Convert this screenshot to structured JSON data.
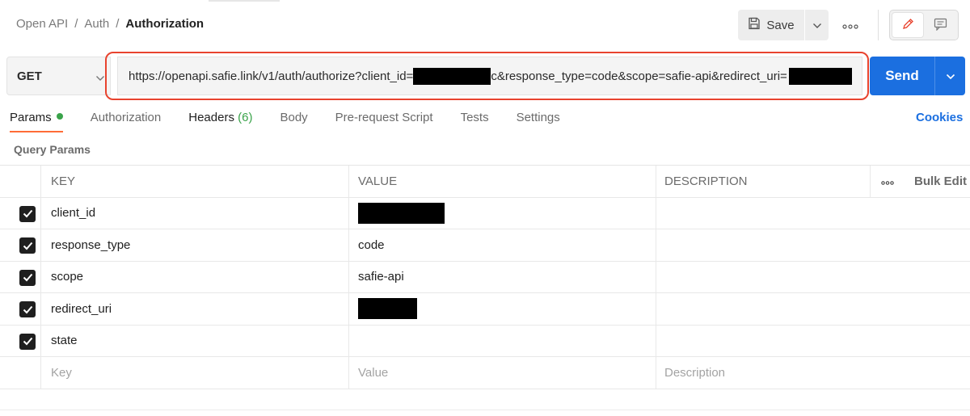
{
  "breadcrumb": {
    "items": [
      "Open API",
      "Auth"
    ],
    "separator": "/",
    "current": "Authorization"
  },
  "toolbar": {
    "save_label": "Save",
    "icons": [
      "save-icon",
      "chevron-down-icon",
      "more-icon",
      "pencil-icon",
      "comment-icon"
    ]
  },
  "request": {
    "method": "GET",
    "url_part1": "https://openapi.safie.link/v1/auth/authorize?client_id=",
    "url_part2": "c&response_type=code&scope=safie-api&redirect_uri=",
    "send_label": "Send"
  },
  "tabs": [
    {
      "label": "Params",
      "active": true
    },
    {
      "label": "Authorization"
    },
    {
      "label": "Headers",
      "count": "(6)"
    },
    {
      "label": "Body"
    },
    {
      "label": "Pre-request Script"
    },
    {
      "label": "Tests"
    },
    {
      "label": "Settings"
    }
  ],
  "cookies_label": "Cookies",
  "section_title": "Query Params",
  "table": {
    "headers": {
      "key": "KEY",
      "value": "VALUE",
      "description": "DESCRIPTION",
      "bulk": "Bulk Edit"
    },
    "rows": [
      {
        "key": "client_id",
        "value": "",
        "redacted": true,
        "checked": true
      },
      {
        "key": "response_type",
        "value": "code",
        "checked": true
      },
      {
        "key": "scope",
        "value": "safie-api",
        "checked": true
      },
      {
        "key": "redirect_uri",
        "value": "",
        "redacted": true,
        "checked": true
      },
      {
        "key": "state",
        "value": "",
        "checked": true
      }
    ],
    "placeholders": {
      "key": "Key",
      "value": "Value",
      "description": "Description"
    }
  },
  "colors": {
    "accent_blue": "#1b6fe0",
    "highlight_red": "#e8432e",
    "active_tab_underline": "#ff6c37",
    "status_green": "#3aa34a"
  }
}
